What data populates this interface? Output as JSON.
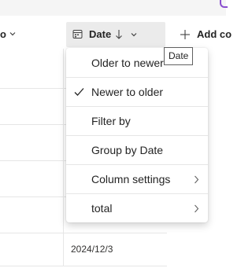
{
  "header": {
    "left_column_label": "o",
    "date_column": {
      "label": "Date",
      "sort_direction": "descending"
    },
    "add_column_label": "Add co"
  },
  "tooltip": {
    "text": "Date"
  },
  "menu": {
    "items": [
      {
        "label": "Older to newer",
        "checked": false,
        "has_submenu": false
      },
      {
        "label": "Newer to older",
        "checked": true,
        "has_submenu": false
      },
      {
        "label": "Filter by",
        "checked": false,
        "has_submenu": false
      },
      {
        "label": "Group by Date",
        "checked": false,
        "has_submenu": false
      },
      {
        "label": "Column settings",
        "checked": false,
        "has_submenu": true
      },
      {
        "label": "total",
        "checked": false,
        "has_submenu": true
      }
    ]
  },
  "rows": [
    {
      "date": ""
    },
    {
      "date": ""
    },
    {
      "date": ""
    },
    {
      "date": ""
    },
    {
      "date": ""
    },
    {
      "date": "2024/12/3"
    }
  ],
  "colors": {
    "accent_corner": "#8a4fcf",
    "header_hover_bg": "#ebebeb"
  },
  "icons": [
    "calendar-icon",
    "sort-down-arrow-icon",
    "chevron-down-icon",
    "plus-icon",
    "check-icon",
    "chevron-right-icon"
  ]
}
